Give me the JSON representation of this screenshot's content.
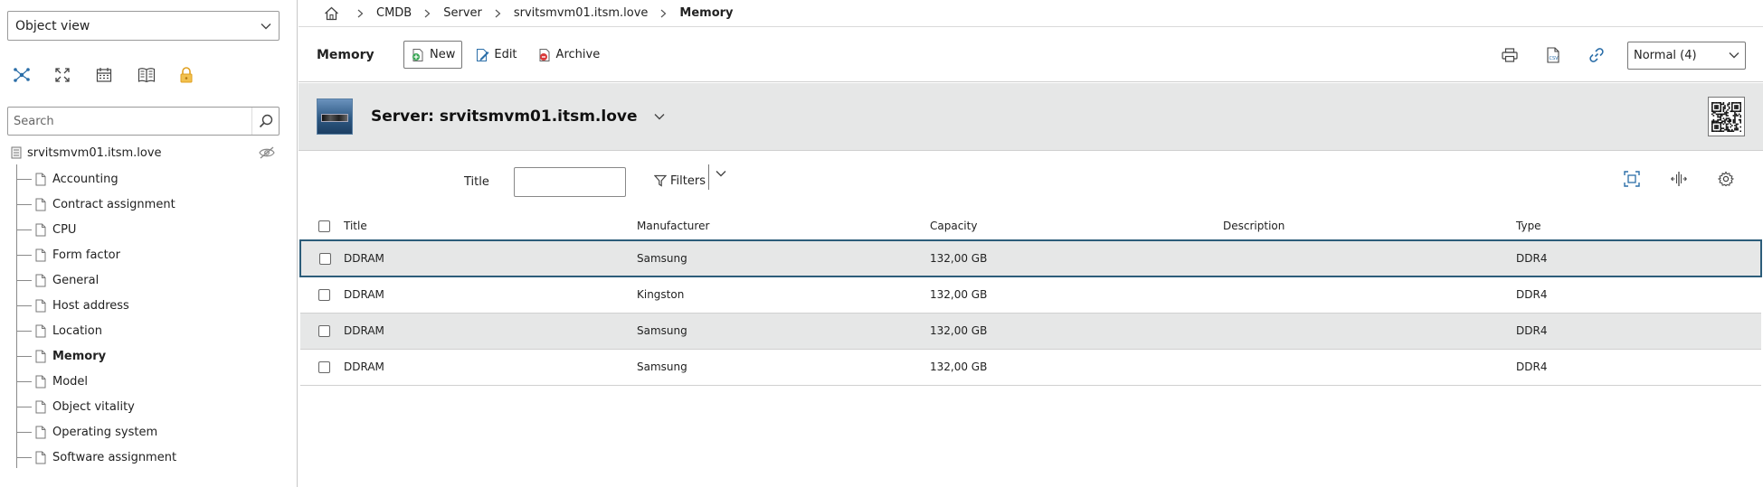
{
  "left": {
    "view_select": "Object view",
    "tools": [
      {
        "icon": "relations-icon"
      },
      {
        "icon": "expand-icon"
      },
      {
        "icon": "calendar-icon"
      },
      {
        "icon": "book-icon"
      },
      {
        "icon": "lock-icon"
      }
    ],
    "search_placeholder": "Search",
    "tree": {
      "root": "srvitsmvm01.itsm.love",
      "items": [
        "Accounting",
        "Contract assignment",
        "CPU",
        "Form factor",
        "General",
        "Host address",
        "Location",
        "Memory",
        "Model",
        "Object vitality",
        "Operating system",
        "Software assignment"
      ],
      "active": "Memory"
    }
  },
  "breadcrumb": [
    "CMDB",
    "Server",
    "srvitsmvm01.itsm.love",
    "Memory"
  ],
  "toolbar": {
    "title": "Memory",
    "new_label": "New",
    "edit_label": "Edit",
    "archive_label": "Archive",
    "level_select": "Normal (4)"
  },
  "object": {
    "title": "Server: srvitsmvm01.itsm.love"
  },
  "filter": {
    "title_label": "Title",
    "filters_label": "Filters"
  },
  "table": {
    "columns": [
      "Title",
      "Manufacturer",
      "Capacity",
      "Description",
      "Type"
    ],
    "rows": [
      {
        "title": "DDRAM",
        "manufacturer": "Samsung",
        "capacity": "132,00 GB",
        "description": "",
        "type": "DDR4"
      },
      {
        "title": "DDRAM",
        "manufacturer": "Kingston",
        "capacity": "132,00 GB",
        "description": "",
        "type": "DDR4"
      },
      {
        "title": "DDRAM",
        "manufacturer": "Samsung",
        "capacity": "132,00 GB",
        "description": "",
        "type": "DDR4"
      },
      {
        "title": "DDRAM",
        "manufacturer": "Samsung",
        "capacity": "132,00 GB",
        "description": "",
        "type": "DDR4"
      }
    ]
  },
  "colors": {
    "accent": "#2c5d7a",
    "header_bg": "#e6e7e7",
    "icon_blue": "#2b6ea8",
    "lock_orange": "#e0a020"
  }
}
